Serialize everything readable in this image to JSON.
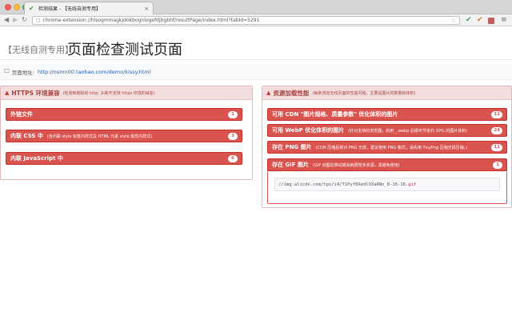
{
  "browser": {
    "tab_title": "检测结果 - 【无线自测专用】",
    "url": "chrome-extension://hlsogmmagkjdokbognlogefdjbgbhf/resultPage/index.html?tabId=5291"
  },
  "header": {
    "tag": "【无线自测专用】",
    "title": "页面检查测试页面"
  },
  "page_address": {
    "label": "页面地址:",
    "url": "http://osmn00.taobao.com/demo/kissy.html"
  },
  "left_panel": {
    "title": "HTTPS 环境兼容",
    "subtitle": "(检测到剔除的 http: 头和不支持 https 环境的域名)",
    "items": [
      {
        "title": "外链文件",
        "note": "",
        "count": "1"
      },
      {
        "title": "内联 CSS 中",
        "note": "(含内联 style 标签内样式及 HTML 元素 style 属性内样式)",
        "count": "3"
      },
      {
        "title": "内联 JavaScript 中",
        "note": "",
        "count": "6"
      }
    ]
  },
  "right_panel": {
    "title": "资源加载性能",
    "subtitle": "(每条流动无线页面的性能问题，主要是图片的数量和体积)",
    "items": [
      {
        "title": "可用 CDN \"图片规格、质量参数\" 优化体积的图片",
        "note": "",
        "count": "11"
      },
      {
        "title": "可用 WebP 优化体积的图片",
        "note": "(针对支持的浏览器，启用 _.webp 后缀可节省约 30% 的图片体积)",
        "count": "24"
      },
      {
        "title": "存在 PNG 图片",
        "note": "(CDN 压缩后候对 PNG 无效，建议使用 PNG 格式，请先用 TinyPng 压缩无损压缩。)",
        "count": "11"
      },
      {
        "title": "存在 GIF 图片",
        "note": "(GIF 动图在移动端会耗费较多资源，需避免使用)",
        "count": "1"
      }
    ],
    "gif_entry": {
      "path": "//img.alicdn.com/tps/i4/T1Pyf8XedlXXaRNx_8-16-16",
      "ext": ".gif"
    }
  },
  "colors": {
    "accent_red": "#d9534f",
    "panel_head_bg": "#f2dede",
    "panel_text": "#a94442",
    "link_blue": "#2a5db0"
  },
  "icons": [
    "warning-icon",
    "monitor-icon",
    "check-icon",
    "lock-icon",
    "star-icon",
    "menu-icon"
  ]
}
